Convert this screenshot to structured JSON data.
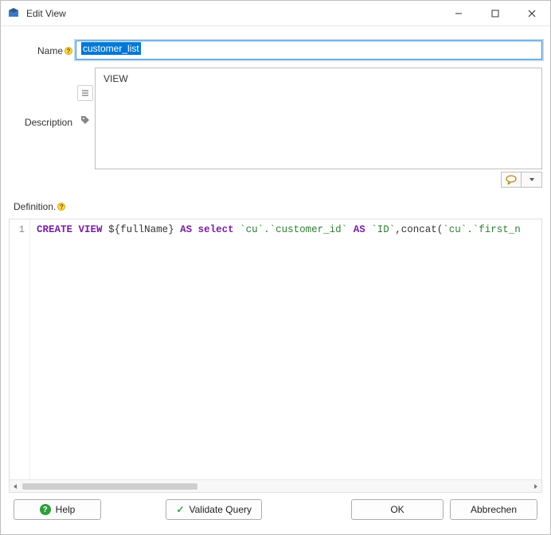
{
  "window": {
    "title": "Edit View"
  },
  "form": {
    "name_label": "Name",
    "name_value": "customer_list",
    "description_label": "Description",
    "description_value": "VIEW",
    "definition_label": "Definition."
  },
  "editor": {
    "gutter_line": "1",
    "code_tokens": {
      "kw_create": "CREATE",
      "kw_view": "VIEW",
      "tmpl": "${fullName}",
      "kw_as1": "AS",
      "kw_select": "select",
      "col1": "`cu`.`customer_id`",
      "kw_as2": "AS",
      "alias1": "`ID`",
      "comma_concat": ",concat(",
      "col2": "`cu`.`first_n"
    }
  },
  "buttons": {
    "help": "Help",
    "validate": "Validate Query",
    "ok": "OK",
    "cancel": "Abbrechen"
  }
}
